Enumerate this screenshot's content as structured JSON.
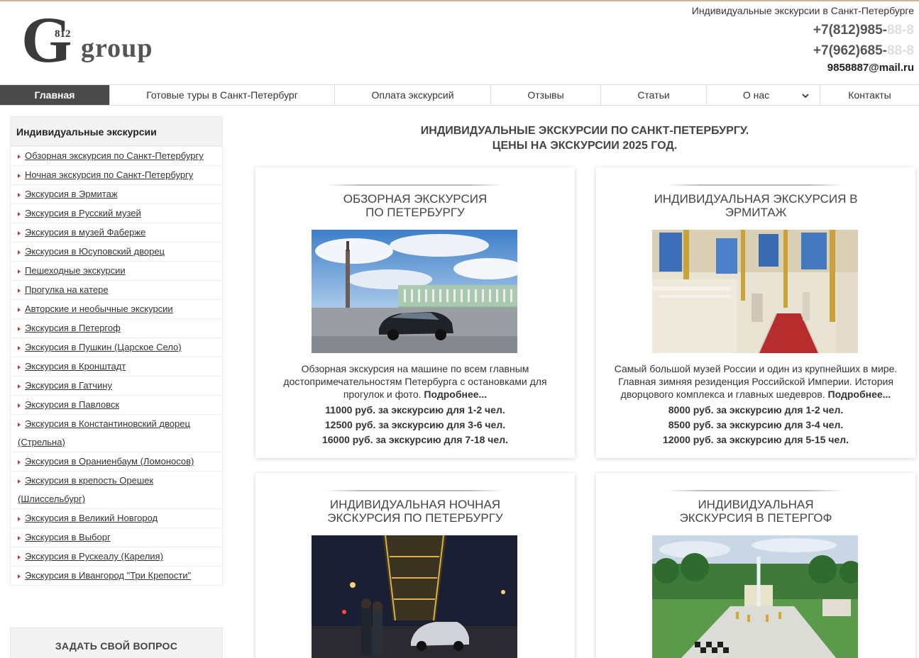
{
  "header": {
    "logo_letter": "G",
    "logo_number": "812",
    "logo_word": "group",
    "tagline": "Индивидуальные экскурсии в Санкт-Петербурге",
    "phone1_main": "+7(812)985-",
    "phone1_fade": "88-8",
    "phone2_main": "+7(962)685-",
    "phone2_fade": "88-8",
    "email": "9858887@mail.ru"
  },
  "nav": {
    "items": [
      {
        "label": "Главная"
      },
      {
        "label": "Готовые туры в Санкт-Петербург"
      },
      {
        "label": "Оплата экскурсий"
      },
      {
        "label": "Отзывы"
      },
      {
        "label": "Статьи"
      },
      {
        "label": "О нас"
      },
      {
        "label": "Контакты"
      }
    ]
  },
  "sidebar": {
    "title": "Индивидуальные экскурсии",
    "items": [
      {
        "label": "Обзорная экскурсия по Санкт-Петербургу"
      },
      {
        "label": "Ночная экскурсия по Санкт-Петербургу"
      },
      {
        "label": "Экскурсия в Эрмитаж"
      },
      {
        "label": "Экскурсия в Русский музей"
      },
      {
        "label": "Экскурсия в музей Фаберже"
      },
      {
        "label": "Экскурсия в Юсуповский дворец"
      },
      {
        "label": "Пешеходные экскурсии"
      },
      {
        "label": "Прогулка на катере"
      },
      {
        "label": "Авторские и необычные экскурсии"
      },
      {
        "label": "Экскурсия в Петергоф"
      },
      {
        "label": "Экскурсия в Пушкин (Царское Село)"
      },
      {
        "label": "Экскурсия в Кронштадт"
      },
      {
        "label": "Экскурсия в Гатчину"
      },
      {
        "label": "Экскурсия в Павловск"
      },
      {
        "label": "Экскурсия в Константиновский дворец",
        "label2": "(Стрельна)"
      },
      {
        "label": "Экскурсия в Ораниенбаум (Ломоносов)"
      },
      {
        "label": "Экскурсия в крепость Орешек",
        "label2": "(Шлиссельбург)"
      },
      {
        "label": "Экскурсия в Великий Новгород"
      },
      {
        "label": "Экскурсия в Выборг"
      },
      {
        "label": "Экскурсия в Рускеалу (Карелия)"
      },
      {
        "label": "Экскурсия в Ивангород \"Три Крепости\""
      }
    ],
    "ask_label": "ЗАДАТЬ СВОЙ ВОПРОС"
  },
  "main": {
    "title_line1": "ИНДИВИДУАЛЬНЫЕ ЭКСКУРСИИ ПО САНКТ-ПЕТЕРБУРГУ.",
    "title_line2": "ЦЕНЫ НА ЭКСКУРСИИ 2025 ГОД.",
    "cards": [
      {
        "title_line1": "Обзорная экскурсия",
        "title_line2": "по Петербургу",
        "desc": "Обзорная экскурсия на машине по всем главным достопримечательностям Петербурга с остановками для прогулок и фото. ",
        "more": "Подробнее...",
        "prices": [
          "11000 руб. за экскурсию для 1-2 чел.",
          "12500 руб. за экскурсию для 3-6 чел.",
          "16000 руб. за экскурсию для 7-18 чел."
        ]
      },
      {
        "title_line1": "Индивидуальная экскурсия в",
        "title_line2": "Эрмитаж",
        "desc": "Самый большой музей России и один из крупнейших в мире. Главная зимняя резиденция Российской Империи. История дворцового комплекса и главных шедевров. ",
        "more": "Подробнее...",
        "prices": [
          "8000 руб. за экскурсию для 1-2 чел.",
          "8500 руб. за экскурсию для 3-4 чел.",
          "12000 руб. за экскурсию для 5-15 чел."
        ]
      },
      {
        "title_line1": "Индивидуальная ночная",
        "title_line2": "экскурсия по Петербургу"
      },
      {
        "title_line1": "Индивидуальная",
        "title_line2": "экскурсия в Петергоф"
      }
    ]
  }
}
